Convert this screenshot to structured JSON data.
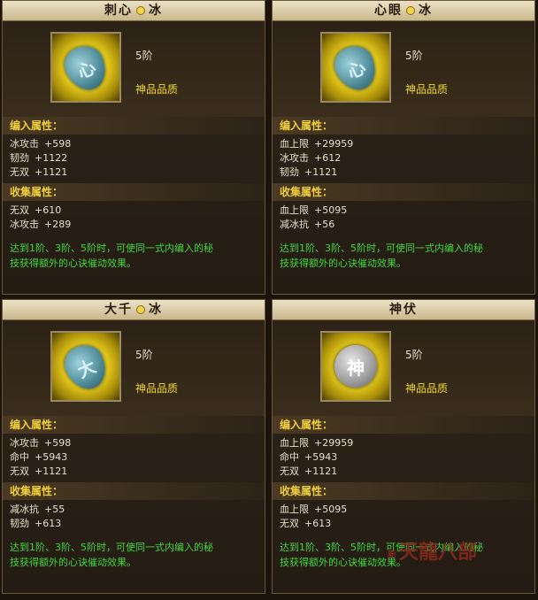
{
  "cards": [
    {
      "title_left": "刺心",
      "title_right": "冰",
      "icon": "ice-rune-stone-icon",
      "icon_glyph": "心",
      "tier": "5阶",
      "quality": "神品品质",
      "inlay_header": "编入属性：",
      "inlay": [
        {
          "name": "冰攻击",
          "value": "+598"
        },
        {
          "name": "韧劲",
          "value": "+1122"
        },
        {
          "name": "无双",
          "value": "+1121"
        }
      ],
      "collect_header": "收集属性：",
      "collect": [
        {
          "name": "无双",
          "value": "+610"
        },
        {
          "name": "冰攻击",
          "value": "+289"
        }
      ],
      "desc": [
        "达到1阶、3阶、5阶时，可使同一式内编入的秘",
        "技获得额外的心诀催动效果。"
      ]
    },
    {
      "title_left": "心眼",
      "title_right": "冰",
      "icon": "ice-rune-stone-icon",
      "icon_glyph": "心",
      "tier": "5阶",
      "quality": "神品品质",
      "inlay_header": "编入属性：",
      "inlay": [
        {
          "name": "血上限",
          "value": "+29959"
        },
        {
          "name": "冰攻击",
          "value": "+612"
        },
        {
          "name": "韧劲",
          "value": "+1121"
        }
      ],
      "collect_header": "收集属性：",
      "collect": [
        {
          "name": "血上限",
          "value": "+5095"
        },
        {
          "name": "减冰抗",
          "value": "+56"
        }
      ],
      "desc": [
        "达到1阶、3阶、5阶时，可使同一式内编入的秘",
        "技获得额外的心诀催动效果。"
      ]
    },
    {
      "title_left": "大千",
      "title_right": "冰",
      "icon": "ice-rune-stone-icon",
      "icon_glyph": "大",
      "tier": "5阶",
      "quality": "神品品质",
      "inlay_header": "编入属性：",
      "inlay": [
        {
          "name": "冰攻击",
          "value": "+598"
        },
        {
          "name": "命中",
          "value": "+5943"
        },
        {
          "name": "无双",
          "value": "+1121"
        }
      ],
      "collect_header": "收集属性：",
      "collect": [
        {
          "name": "减冰抗",
          "value": "+55"
        },
        {
          "name": "韧劲",
          "value": "+613"
        }
      ],
      "desc": [
        "达到1阶、3阶、5阶时，可使同一式内编入的秘",
        "技获得额外的心诀催动效果。"
      ]
    },
    {
      "title_left": "神伏",
      "title_right": "",
      "icon": "gray-rune-stone-icon",
      "icon_glyph": "神",
      "tier": "5阶",
      "quality": "神品品质",
      "inlay_header": "编入属性：",
      "inlay": [
        {
          "name": "血上限",
          "value": "+29959"
        },
        {
          "name": "命中",
          "value": "+5943"
        },
        {
          "name": "无双",
          "value": "+1121"
        }
      ],
      "collect_header": "收集属性：",
      "collect": [
        {
          "name": "血上限",
          "value": "+5095"
        },
        {
          "name": "无双",
          "value": "+613"
        }
      ],
      "desc": [
        "达到1阶、3阶、5阶时，可使同一式内编入的秘",
        "技获得额外的心诀催动效果。"
      ]
    }
  ],
  "watermark": {
    "prefix": "新",
    "text": "天龍八部"
  }
}
